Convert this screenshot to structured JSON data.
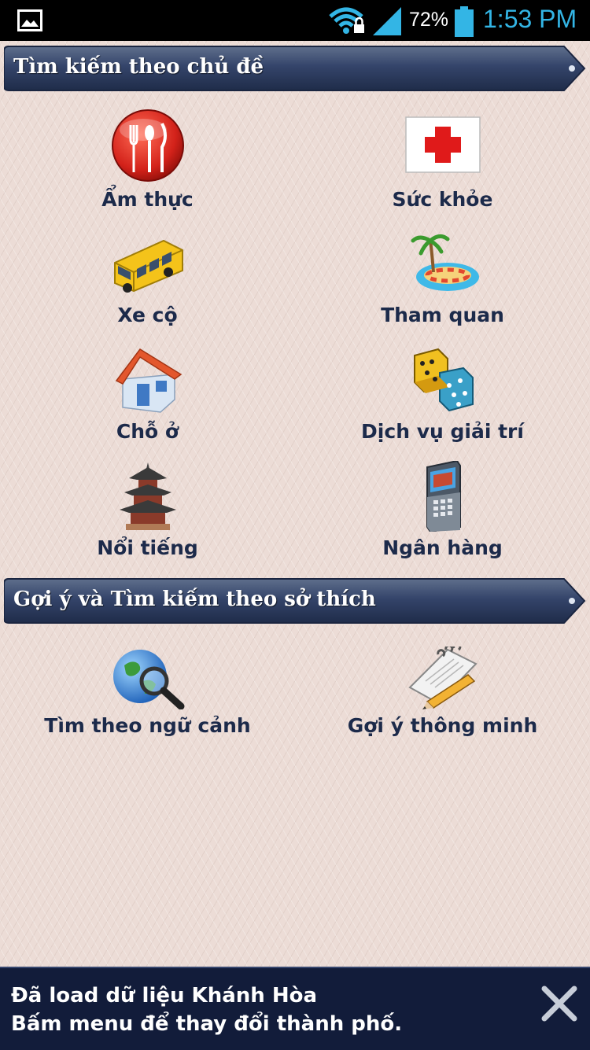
{
  "status_bar": {
    "battery_text": "72%",
    "time": "1:53 PM",
    "icons": [
      "image-icon",
      "wifi-lock-icon",
      "cell-signal-icon",
      "battery-icon"
    ],
    "accent_color": "#33b5e5"
  },
  "topic_section": {
    "title": "Tìm kiếm theo chủ đề",
    "items": [
      {
        "label": "Ẩm thực",
        "icon": "dining-icon"
      },
      {
        "label": "Sức khỏe",
        "icon": "red-cross-icon"
      },
      {
        "label": "Xe cộ",
        "icon": "bus-icon"
      },
      {
        "label": "Tham quan",
        "icon": "island-icon"
      },
      {
        "label": "Chỗ ở",
        "icon": "house-icon"
      },
      {
        "label": "Dịch vụ giải trí",
        "icon": "dice-icon"
      },
      {
        "label": "Nổi tiếng",
        "icon": "pagoda-icon"
      },
      {
        "label": "Ngân hàng",
        "icon": "atm-icon"
      }
    ]
  },
  "interest_section": {
    "title": "Gợi ý và Tìm kiếm theo sở thích",
    "items": [
      {
        "label": "Tìm theo ngữ cảnh",
        "icon": "globe-search-icon"
      },
      {
        "label": "Gợi ý thông minh",
        "icon": "notepad-pencil-icon"
      }
    ]
  },
  "banner": {
    "line1": "Đã load dữ liệu Khánh Hòa",
    "line2": "Bấm menu để thay đổi thành phố.",
    "close_icon": "close-icon"
  },
  "colors": {
    "header_bg": "#2f3f5f",
    "label_text": "#1c2a4a",
    "banner_bg": "#121c3a"
  }
}
